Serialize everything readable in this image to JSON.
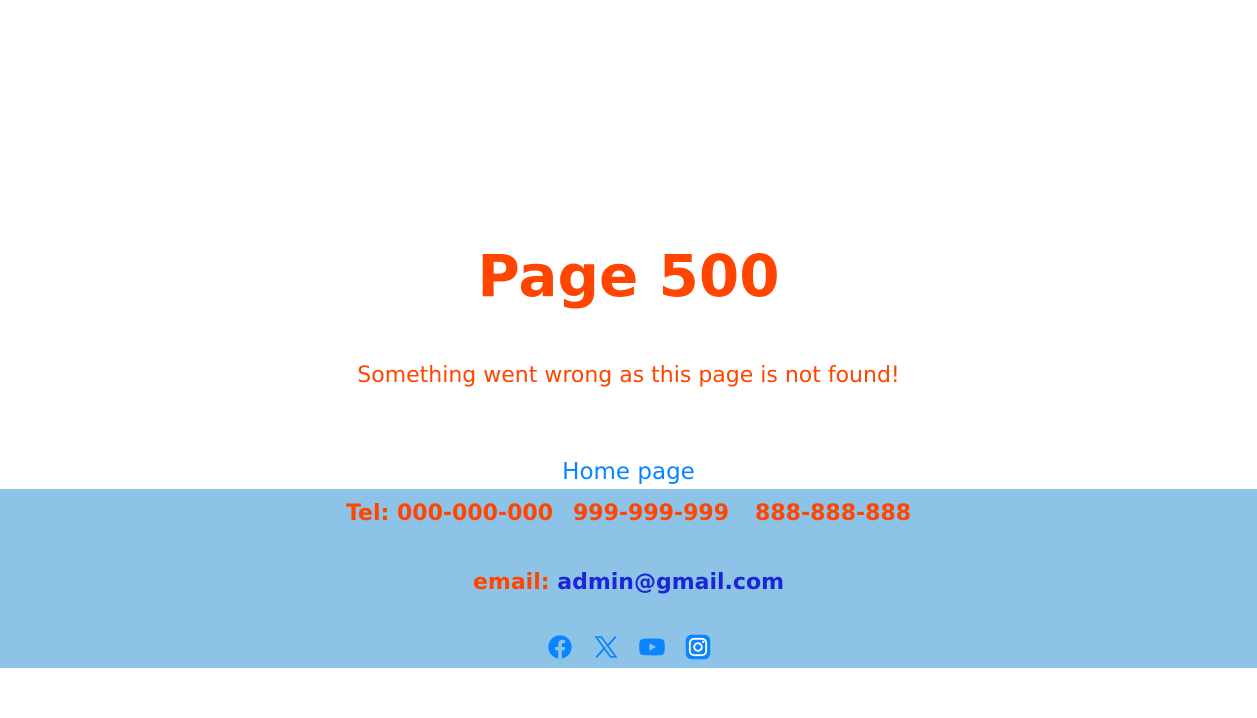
{
  "main": {
    "title": "Page 500",
    "message": "Something went wrong as this page is not found!",
    "home_link": "Home page"
  },
  "footer": {
    "background": "#8ec3e8",
    "tel_label": "Tel:",
    "phones": [
      "000-000-000",
      "999-999-999",
      "888-888-888"
    ],
    "email_label": "email:",
    "email": "admin@gmail.com",
    "socials": [
      {
        "name": "facebook",
        "icon": "facebook-icon"
      },
      {
        "name": "x",
        "icon": "x-icon"
      },
      {
        "name": "youtube",
        "icon": "youtube-icon"
      },
      {
        "name": "instagram",
        "icon": "instagram-icon"
      }
    ]
  },
  "colors": {
    "accent": "#ff4500",
    "link": "#0a84ff",
    "email": "#1c26d6",
    "icon": "#0a84ff"
  }
}
